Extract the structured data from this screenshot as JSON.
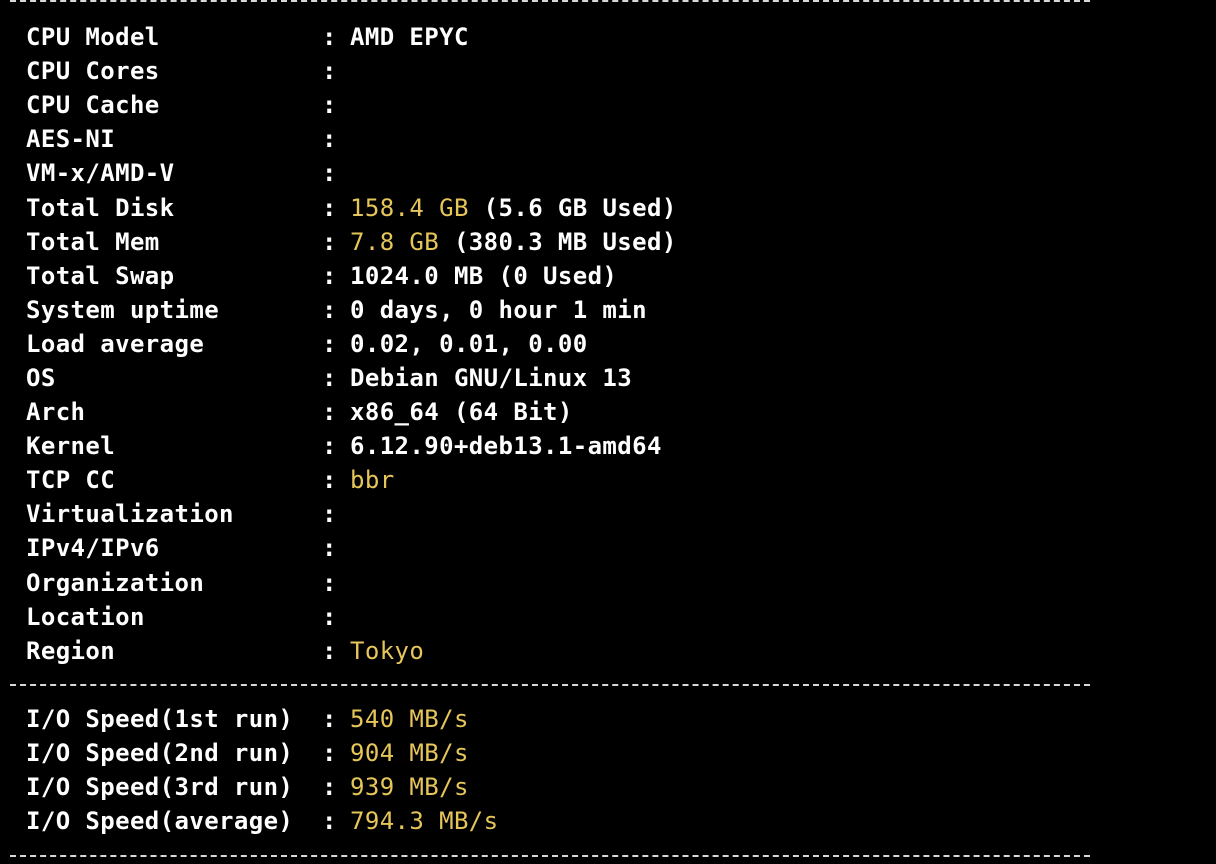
{
  "separator": "------------------------------------------------------------------------------------",
  "colors": {
    "background": "#000000",
    "text": "#ffffff",
    "highlight": "#e6c65a"
  },
  "system_info": [
    {
      "label": "CPU Model",
      "value": "AMD EPYC",
      "highlight": "",
      "note": ""
    },
    {
      "label": "CPU Cores",
      "value": "",
      "highlight": "",
      "note": ""
    },
    {
      "label": "CPU Cache",
      "value": "",
      "highlight": "",
      "note": ""
    },
    {
      "label": "AES-NI",
      "value": "",
      "highlight": "",
      "note": ""
    },
    {
      "label": "VM-x/AMD-V",
      "value": "",
      "highlight": "",
      "note": ""
    },
    {
      "label": "Total Disk",
      "value": "",
      "highlight": "158.4 GB",
      "note": " (5.6 GB Used)"
    },
    {
      "label": "Total Mem",
      "value": "",
      "highlight": "7.8 GB",
      "note": " (380.3 MB Used)"
    },
    {
      "label": "Total Swap",
      "value": "1024.0 MB (0 Used)",
      "highlight": "",
      "note": ""
    },
    {
      "label": "System uptime",
      "value": "0 days, 0 hour 1 min",
      "highlight": "",
      "note": ""
    },
    {
      "label": "Load average",
      "value": "0.02, 0.01, 0.00",
      "highlight": "",
      "note": ""
    },
    {
      "label": "OS",
      "value": "Debian GNU/Linux 13",
      "highlight": "",
      "note": ""
    },
    {
      "label": "Arch",
      "value": "x86_64 (64 Bit)",
      "highlight": "",
      "note": ""
    },
    {
      "label": "Kernel",
      "value": "6.12.90+deb13.1-amd64",
      "highlight": "",
      "note": ""
    },
    {
      "label": "TCP CC",
      "value": "",
      "highlight": "bbr",
      "note": ""
    },
    {
      "label": "Virtualization",
      "value": "",
      "highlight": "",
      "note": ""
    },
    {
      "label": "IPv4/IPv6",
      "value": "",
      "highlight": "",
      "note": ""
    },
    {
      "label": "Organization",
      "value": "",
      "highlight": "",
      "note": ""
    },
    {
      "label": "Location",
      "value": "",
      "highlight": "",
      "note": ""
    },
    {
      "label": "Region",
      "value": "",
      "highlight": "Tokyo",
      "note": ""
    }
  ],
  "io_speed": [
    {
      "label": "I/O Speed(1st run)",
      "value": "",
      "highlight": "540 MB/s",
      "note": ""
    },
    {
      "label": "I/O Speed(2nd run)",
      "value": "",
      "highlight": "904 MB/s",
      "note": ""
    },
    {
      "label": "I/O Speed(3rd run)",
      "value": "",
      "highlight": "939 MB/s",
      "note": ""
    },
    {
      "label": "I/O Speed(average)",
      "value": "",
      "highlight": "794.3 MB/s",
      "note": ""
    }
  ],
  "separator_char": ":"
}
